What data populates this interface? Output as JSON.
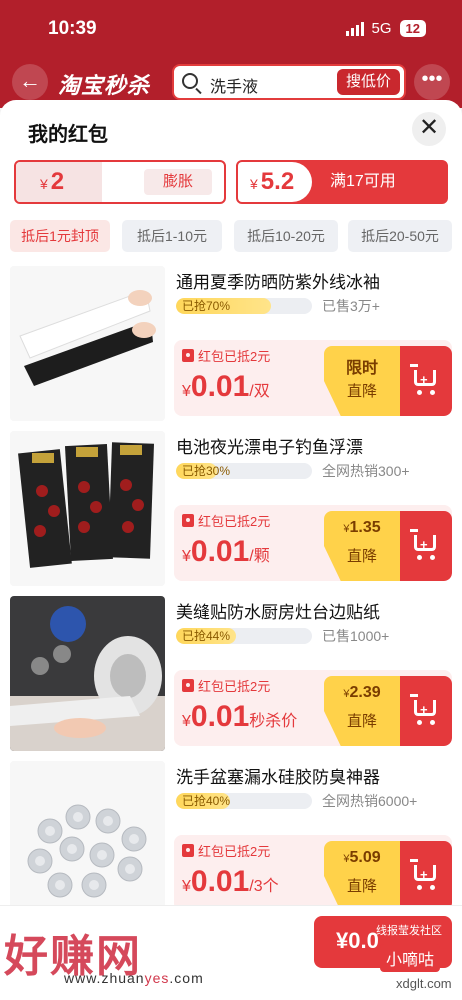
{
  "status": {
    "time": "10:39",
    "network": "5G",
    "battery": "12"
  },
  "topbar": {
    "logo": "淘宝秒杀",
    "search_text": "洗手液",
    "search_button": "搜低价"
  },
  "sheet": {
    "title": "我的红包"
  },
  "packets": [
    {
      "currency": "¥",
      "amount": "2",
      "label": "膨胀"
    },
    {
      "currency": "¥",
      "amount": "5.2",
      "label": "满17可用"
    }
  ],
  "filters": [
    "抵后1元封顶",
    "抵后1-10元",
    "抵后10-20元",
    "抵后20-50元"
  ],
  "items": [
    {
      "name": "通用夏季防晒防紫外线冰袖",
      "progress_text": "已抢70%",
      "progress": 0.7,
      "sold": "已售3万+",
      "redpacket": "红包已抵2元",
      "currency": "¥",
      "price": "0.01",
      "unit": "/双",
      "deal_line1": "限时",
      "deal_line2": "直降"
    },
    {
      "name": "电池夜光漂电子钓鱼浮漂",
      "progress_text": "已抢30%",
      "progress": 0.3,
      "sold": "全网热销300+",
      "redpacket": "红包已抵2元",
      "currency": "¥",
      "price": "0.01",
      "unit": "/颗",
      "deal_cur": "¥",
      "deal_line1": "1.35",
      "deal_line2": "直降"
    },
    {
      "name": "美缝贴防水厨房灶台边贴纸",
      "progress_text": "已抢44%",
      "progress": 0.44,
      "sold": "已售1000+",
      "redpacket": "红包已抵2元",
      "currency": "¥",
      "price": "0.01",
      "unit": "秒杀价",
      "deal_cur": "¥",
      "deal_line1": "2.39",
      "deal_line2": "直降"
    },
    {
      "name": "洗手盆塞漏水硅胶防臭神器",
      "progress_text": "已抢40%",
      "progress": 0.4,
      "sold": "全网热销6000+",
      "redpacket": "红包已抵2元",
      "currency": "¥",
      "price": "0.01",
      "unit": "/3个",
      "deal_cur": "¥",
      "deal_line1": "5.09",
      "deal_line2": "直降"
    }
  ],
  "bottom": {
    "price": "¥0.0",
    "tag": "线报莹发社区"
  },
  "watermark": {
    "brand": "好赚网",
    "url_a": "www.zhuan",
    "url_b": "yes",
    "url_c": ".com",
    "badge": "小嘀咕",
    "site": "xdglt.com"
  },
  "colors": {
    "brand_red": "#e4393c",
    "header_red": "#b21f2b",
    "deal_yellow": "#ffd24a"
  }
}
